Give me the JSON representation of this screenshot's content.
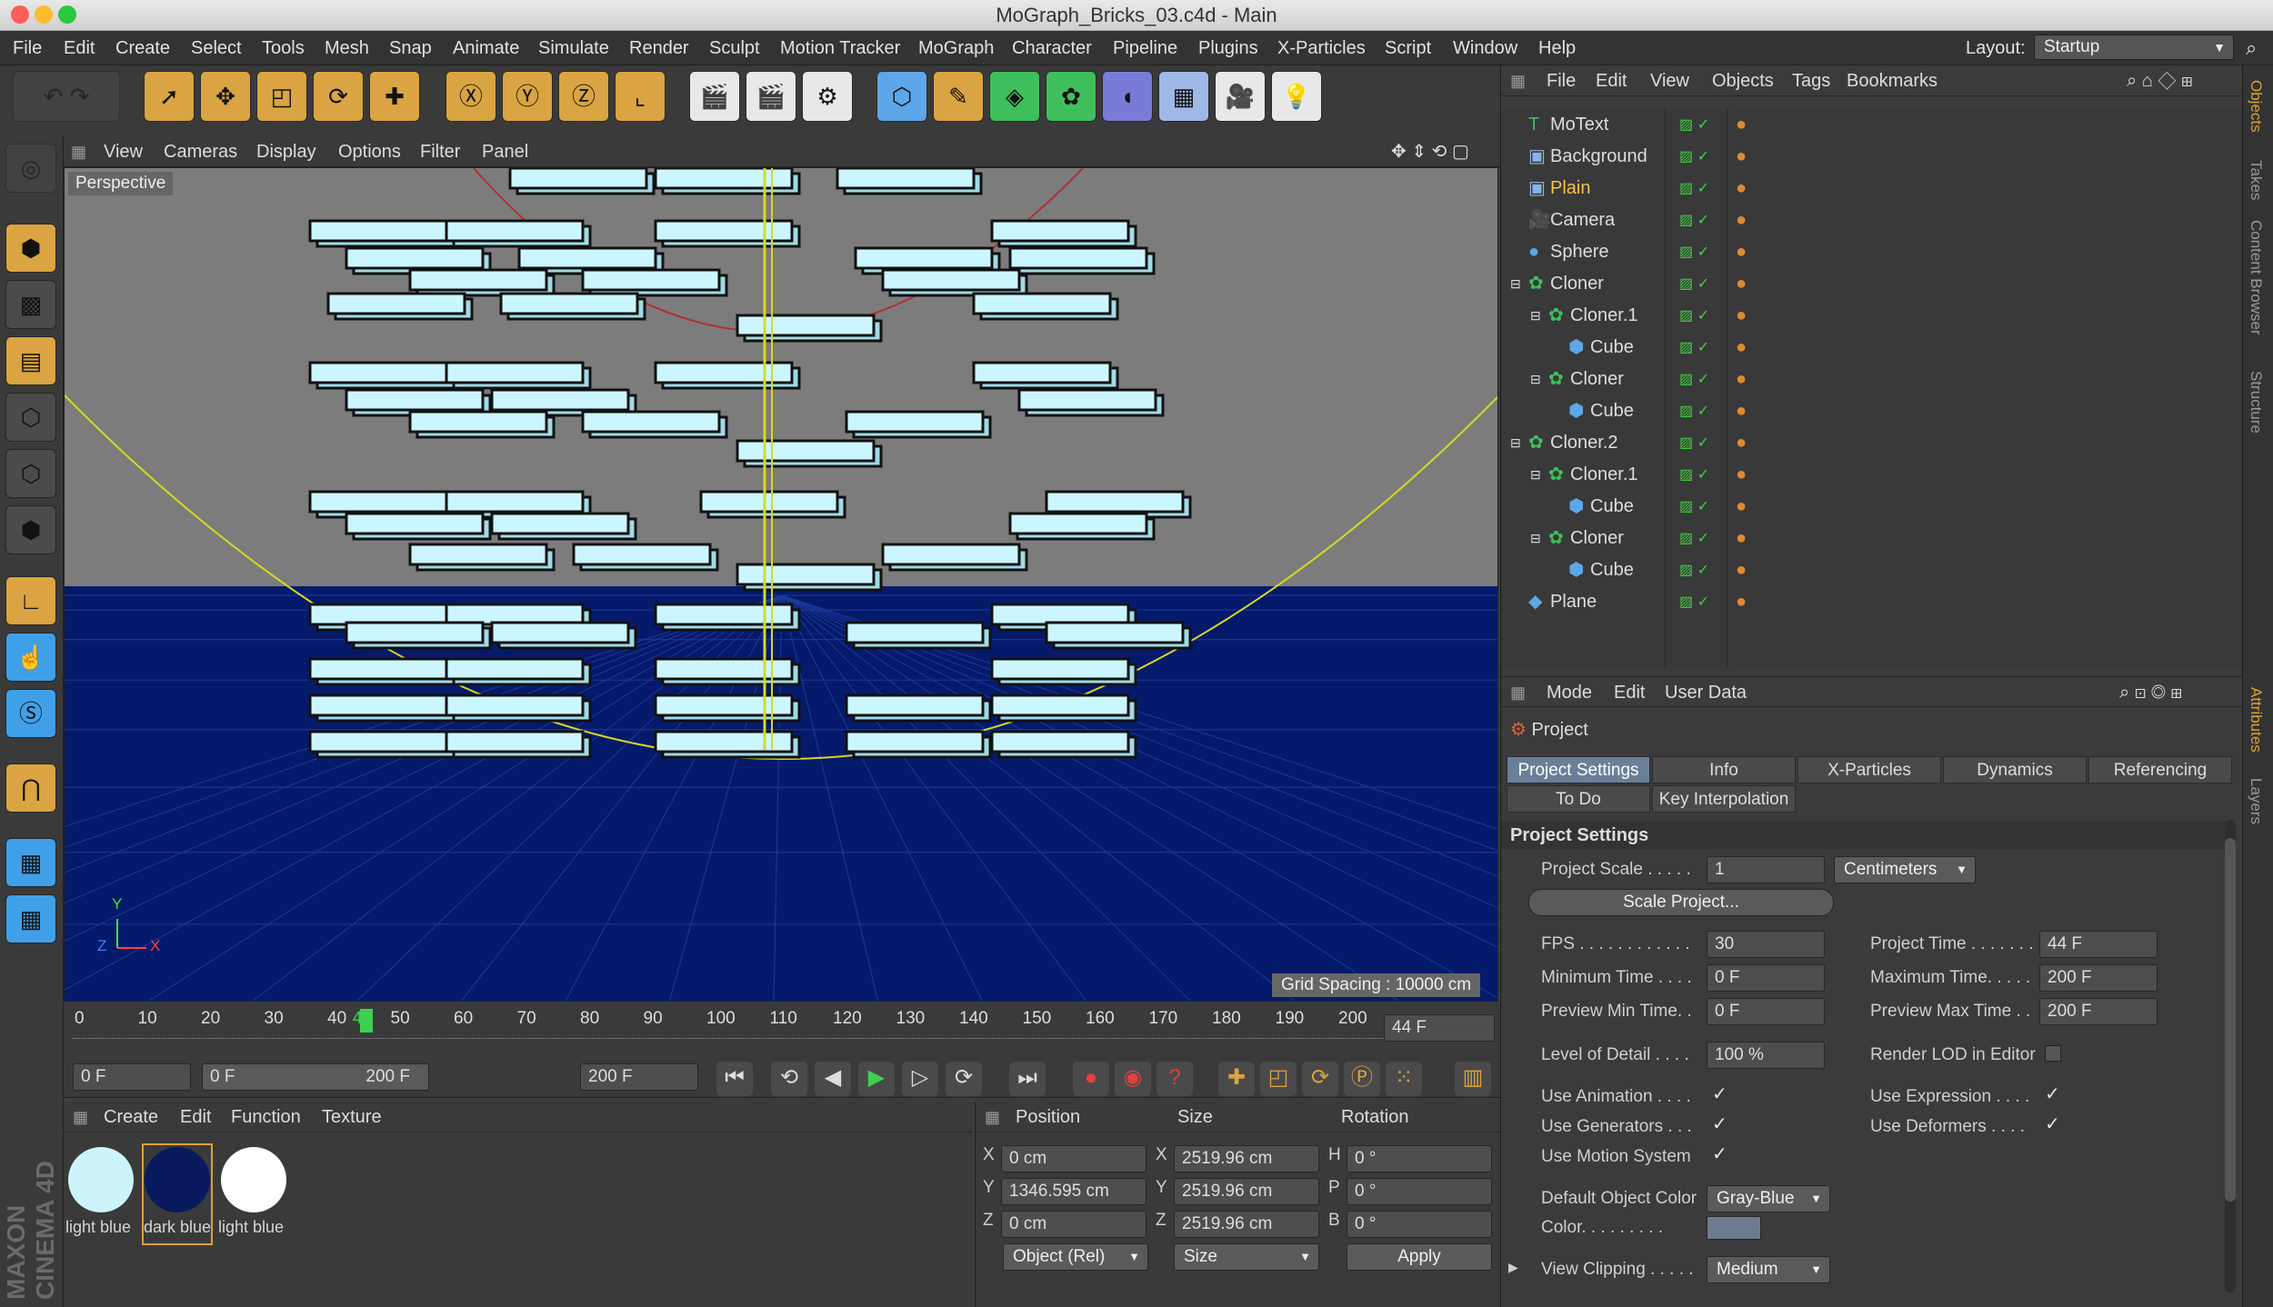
{
  "window": {
    "title": "MoGraph_Bricks_03.c4d - Main"
  },
  "menubar": {
    "items": [
      "File",
      "Edit",
      "Create",
      "Select",
      "Tools",
      "Mesh",
      "Snap",
      "Animate",
      "Simulate",
      "Render",
      "Sculpt",
      "Motion Tracker",
      "MoGraph",
      "Character",
      "Pipeline",
      "Plugins",
      "X-Particles",
      "Script",
      "Window",
      "Help"
    ],
    "layout_label": "Layout:",
    "layout_value": "Startup"
  },
  "viewport": {
    "menu": [
      "View",
      "Cameras",
      "Display",
      "Options",
      "Filter",
      "Panel"
    ],
    "label": "Perspective",
    "grid_spacing": "Grid Spacing : 10000 cm",
    "axis_x": "X",
    "axis_y": "Y",
    "axis_z": "Z",
    "colors": {
      "brick": "#ccf6ff",
      "floor": "#061a6b",
      "bg": "#7a7a7a"
    }
  },
  "timeline": {
    "ticks": [
      "0",
      "10",
      "20",
      "30",
      "40",
      "44",
      "50",
      "60",
      "70",
      "80",
      "90",
      "100",
      "110",
      "120",
      "130",
      "140",
      "150",
      "160",
      "170",
      "180",
      "190",
      "200"
    ],
    "current_frame": "44 F"
  },
  "playbar": {
    "start": "0 F",
    "range_start": "0 F",
    "range_end": "200 F",
    "end": "200 F"
  },
  "materials": {
    "menu": [
      "Create",
      "Edit",
      "Function",
      "Texture"
    ],
    "items": [
      {
        "name": "light blue",
        "color": "#cdf4fb"
      },
      {
        "name": "dark blue",
        "color": "#0a1a5e"
      },
      {
        "name": "light blue",
        "color": "#ffffff"
      }
    ],
    "brand": "MAXON CINEMA 4D"
  },
  "coords": {
    "headers": [
      "Position",
      "Size",
      "Rotation"
    ],
    "rows": [
      {
        "axis": "X",
        "pos": "0 cm",
        "saxis": "X",
        "size": "2519.96 cm",
        "raxis": "H",
        "rot": "0 °"
      },
      {
        "axis": "Y",
        "pos": "1346.595 cm",
        "saxis": "Y",
        "size": "2519.96 cm",
        "raxis": "P",
        "rot": "0 °"
      },
      {
        "axis": "Z",
        "pos": "0 cm",
        "saxis": "Z",
        "size": "2519.96 cm",
        "raxis": "B",
        "rot": "0 °"
      }
    ],
    "mode": "Object (Rel)",
    "size_mode": "Size",
    "apply": "Apply"
  },
  "objects": {
    "menu": [
      "File",
      "Edit",
      "View",
      "Objects",
      "Tags",
      "Bookmarks"
    ],
    "rows": [
      {
        "name": "MoText",
        "level": 0,
        "icon": "T",
        "color": "#ddd"
      },
      {
        "name": "Background",
        "level": 0,
        "icon": "B",
        "color": "#ddd"
      },
      {
        "name": "Plain",
        "level": 0,
        "icon": "P",
        "color": "#f5c542"
      },
      {
        "name": "Camera",
        "level": 0,
        "icon": "C",
        "color": "#ddd"
      },
      {
        "name": "Sphere",
        "level": 0,
        "icon": "S",
        "color": "#ddd"
      },
      {
        "name": "Cloner",
        "level": 0,
        "icon": "G",
        "color": "#ddd"
      },
      {
        "name": "Cloner.1",
        "level": 1,
        "icon": "G",
        "color": "#ddd"
      },
      {
        "name": "Cube",
        "level": 2,
        "icon": "Q",
        "color": "#ddd"
      },
      {
        "name": "Cloner",
        "level": 1,
        "icon": "G",
        "color": "#ddd"
      },
      {
        "name": "Cube",
        "level": 2,
        "icon": "Q",
        "color": "#ddd"
      },
      {
        "name": "Cloner.2",
        "level": 0,
        "icon": "G",
        "color": "#ddd"
      },
      {
        "name": "Cloner.1",
        "level": 1,
        "icon": "G",
        "color": "#ddd"
      },
      {
        "name": "Cube",
        "level": 2,
        "icon": "Q",
        "color": "#ddd"
      },
      {
        "name": "Cloner",
        "level": 1,
        "icon": "G",
        "color": "#ddd"
      },
      {
        "name": "Cube",
        "level": 2,
        "icon": "Q",
        "color": "#ddd"
      },
      {
        "name": "Plane",
        "level": 0,
        "icon": "L",
        "color": "#ddd"
      }
    ]
  },
  "attributes": {
    "menu": [
      "Mode",
      "Edit",
      "User Data"
    ],
    "title": "Project",
    "tabs_row1": [
      "Project Settings",
      "Info",
      "X-Particles",
      "Dynamics",
      "Referencing"
    ],
    "tabs_row2": [
      "To Do",
      "Key Interpolation"
    ],
    "section": "Project Settings",
    "project_scale_label": "Project Scale . . . . .",
    "project_scale": "1",
    "unit": "Centimeters",
    "scale_button": "Scale Project...",
    "fps_label": "FPS . . . . . . . . . . . .",
    "fps": "30",
    "project_time_label": "Project Time . . . . . . .",
    "project_time": "44 F",
    "min_time_label": "Minimum Time . . . .",
    "min_time": "0 F",
    "max_time_label": "Maximum Time. . . . .",
    "max_time": "200 F",
    "prev_min_label": "Preview Min Time. .",
    "prev_min": "0 F",
    "prev_max_label": "Preview Max Time . .",
    "prev_max": "200 F",
    "lod_label": "Level of Detail . . . .",
    "lod": "100 %",
    "render_lod_label": "Render LOD in Editor",
    "use_animation": "Use Animation . . . .",
    "use_expression": "Use Expression . . . .",
    "use_generators": "Use Generators . . .",
    "use_deformers": "Use Deformers . . . .",
    "use_motion": "Use Motion System",
    "default_color_label": "Default Object Color",
    "default_color": "Gray-Blue",
    "color_label": "Color. . . . . . . . .",
    "view_clipping_label": "View Clipping . . . . .",
    "view_clipping": "Medium"
  },
  "side_tabs": {
    "top": [
      "Objects",
      "Takes",
      "Content Browser",
      "Structure"
    ],
    "bottom": [
      "Attributes",
      "Layers"
    ]
  }
}
